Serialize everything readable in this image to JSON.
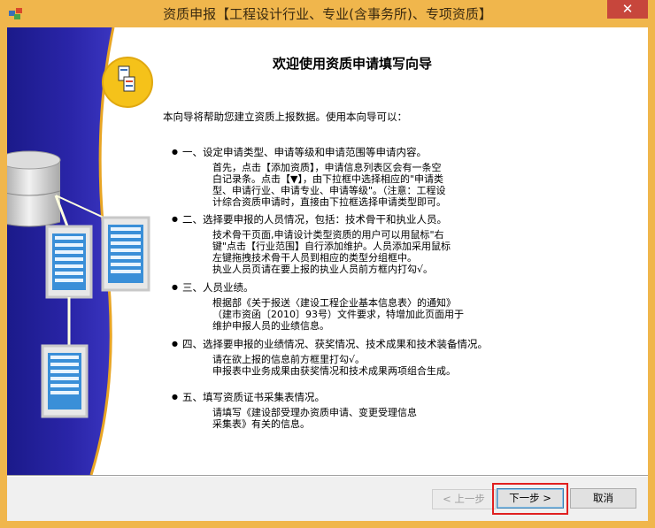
{
  "window": {
    "title": "资质申报【工程设计行业、专业(含事务所)、专项资质】",
    "close_label": "✕"
  },
  "wizard": {
    "heading": "欢迎使用资质申请填写向导",
    "intro": "本向导将帮助您建立资质上报数据。使用本向导可以：",
    "items": [
      {
        "title": "一、设定申请类型、申请等级和申请范围等申请内容。",
        "desc": "首先，点击【添加资质】，申请信息列表区会有一条空\n白记录条。点击【▼】，由下拉框中选择相应的\"申请类\n型、申请行业、申请专业、申请等级\"。（注意：工程设\n计综合资质申请时，直接由下拉框选择申请类型即可。"
      },
      {
        "title": "二、选择要申报的人员情况，包括：技术骨干和执业人员。",
        "desc": "技术骨干页面,申请设计类型资质的用户可以用鼠标\"右\n键\"点击【行业范围】自行添加维护。人员添加采用鼠标\n左键拖拽技术骨干人员到相应的类型分组框中。\n执业人员页请在要上报的执业人员前方框内打勾√。"
      },
      {
        "title": "三、人员业绩。",
        "desc": "根据部《关于报送〈建设工程企业基本信息表〉的通知》\n（建市资函〔2010〕93号）文件要求，特增加此页面用于\n维护申报人员的业绩信息。"
      },
      {
        "title": "四、选择要申报的业绩情况、获奖情况、技术成果和技术装备情况。",
        "desc": "请在欲上报的信息前方框里打勾√。\n申报表中业务成果由获奖情况和技术成果两项组合生成。"
      },
      {
        "title": "五、填写资质证书采集表情况。",
        "desc": "请填写《建设部受理办资质申请、变更受理信息\n采集表》有关的信息。"
      }
    ]
  },
  "buttons": {
    "back": "< 上一步",
    "next": "下一步 >",
    "cancel": "取消"
  },
  "colors": {
    "frame": "#f0b64c",
    "close": "#c7463c",
    "highlight": "#e02020"
  }
}
